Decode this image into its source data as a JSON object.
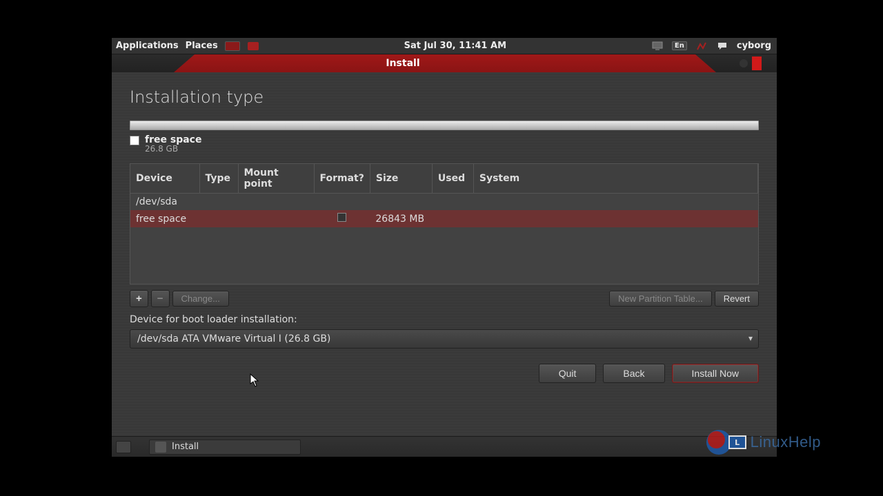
{
  "panel": {
    "apps": "Applications",
    "places": "Places",
    "clock": "Sat Jul 30, 11:41 AM",
    "lang": "En",
    "user": "cyborg"
  },
  "window": {
    "title": "Install",
    "page_title": "Installation type",
    "legend": {
      "name": "free space",
      "size": "26.8 GB"
    },
    "table": {
      "headers": [
        "Device",
        "Type",
        "Mount point",
        "Format?",
        "Size",
        "Used",
        "System"
      ],
      "rows": [
        {
          "device": "/dev/sda",
          "type": "",
          "mount": "",
          "format": null,
          "size": "",
          "used": "",
          "system": "",
          "selected": false
        },
        {
          "device": "  free space",
          "type": "",
          "mount": "",
          "format": false,
          "size": "26843 MB",
          "used": "",
          "system": "",
          "selected": true
        }
      ]
    },
    "actions": {
      "add": "+",
      "remove": "−",
      "change": "Change...",
      "new_table": "New Partition Table...",
      "revert": "Revert"
    },
    "boot_label": "Device for boot loader installation:",
    "boot_device": "/dev/sda  ATA VMware Virtual I (26.8 GB)",
    "buttons": {
      "quit": "Quit",
      "back": "Back",
      "install": "Install Now"
    }
  },
  "taskbar": {
    "install": "Install"
  },
  "watermark": "LinuxHelp"
}
